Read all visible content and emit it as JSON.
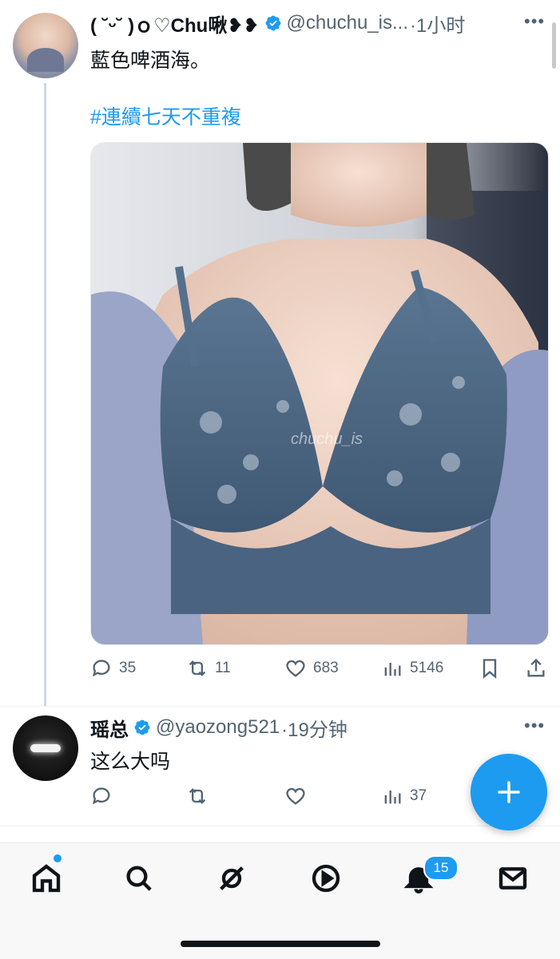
{
  "colors": {
    "accent": "#1d9bf0",
    "text": "#0f1419",
    "secondary": "#536471"
  },
  "tweet1": {
    "display_name": "( ˘ᵕ˘ )ｏ♡Chu啾❥❥",
    "handle": "@chuchu_is...",
    "time": "·1小时",
    "text": "藍色啤酒海。",
    "hashtag": "#連續七天不重複",
    "media_watermark": "chuchu_is",
    "stats": {
      "replies": "35",
      "retweets": "11",
      "likes": "683",
      "views": "5146"
    }
  },
  "tweet2": {
    "display_name": "瑶总",
    "handle": "@yaozong521",
    "time": "·19分钟",
    "text": "这么大吗",
    "stats": {
      "replies": "",
      "retweets": "",
      "likes": "",
      "views": "37"
    }
  },
  "icons": {
    "more": "more-horizontal-icon",
    "verified": "verified-badge-icon",
    "reply": "reply-icon",
    "retweet": "retweet-icon",
    "like": "heart-icon",
    "views": "views-chart-icon",
    "bookmark": "bookmark-icon",
    "share": "share-icon",
    "compose": "plus-icon"
  },
  "bottom_nav": {
    "notifications_badge": "15",
    "items": [
      "home-icon",
      "search-icon",
      "grok-icon",
      "play-icon",
      "bell-icon",
      "mail-icon"
    ]
  }
}
